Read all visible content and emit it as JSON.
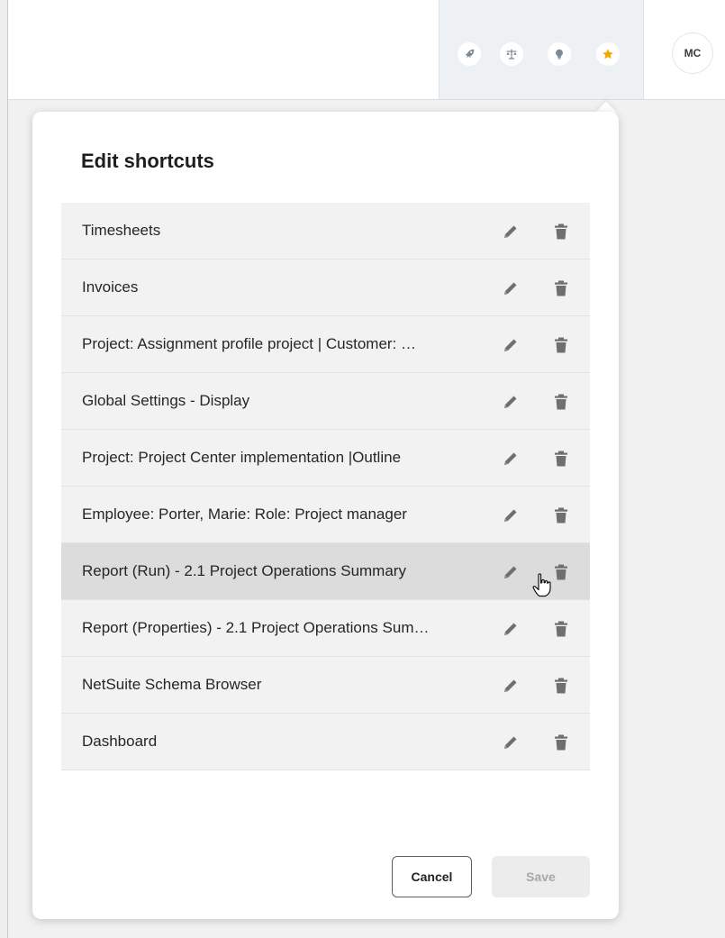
{
  "header": {
    "tray_icons": [
      {
        "name": "rocket-icon",
        "color": "#7d8a96"
      },
      {
        "name": "scale-icon",
        "color": "#7d8a96"
      },
      {
        "name": "lightbulb-icon",
        "color": "#7d8a96"
      },
      {
        "name": "star-icon",
        "color": "#f2a900"
      }
    ],
    "avatar_initials": "MC"
  },
  "popup": {
    "title": "Edit shortcuts",
    "shortcuts": [
      {
        "label": "Timesheets"
      },
      {
        "label": "Invoices"
      },
      {
        "label": "Project: Assignment profile project | Customer: …"
      },
      {
        "label": "Global Settings - Display"
      },
      {
        "label": "Project: Project Center implementation |Outline"
      },
      {
        "label": "Employee: Porter, Marie: Role: Project manager"
      },
      {
        "label": "Report (Run) - 2.1 Project Operations Summary"
      },
      {
        "label": "Report (Properties) - 2.1 Project Operations Sum…"
      },
      {
        "label": "NetSuite Schema Browser"
      },
      {
        "label": "Dashboard"
      }
    ],
    "hovered_row_index": 6,
    "cancel_label": "Cancel",
    "save_label": "Save"
  },
  "colors": {
    "icon_gray": "#6f6f6f",
    "row_background": "#f2f2f2",
    "row_hover_background": "#dcdcdc",
    "favorite_star": "#f2a900"
  }
}
